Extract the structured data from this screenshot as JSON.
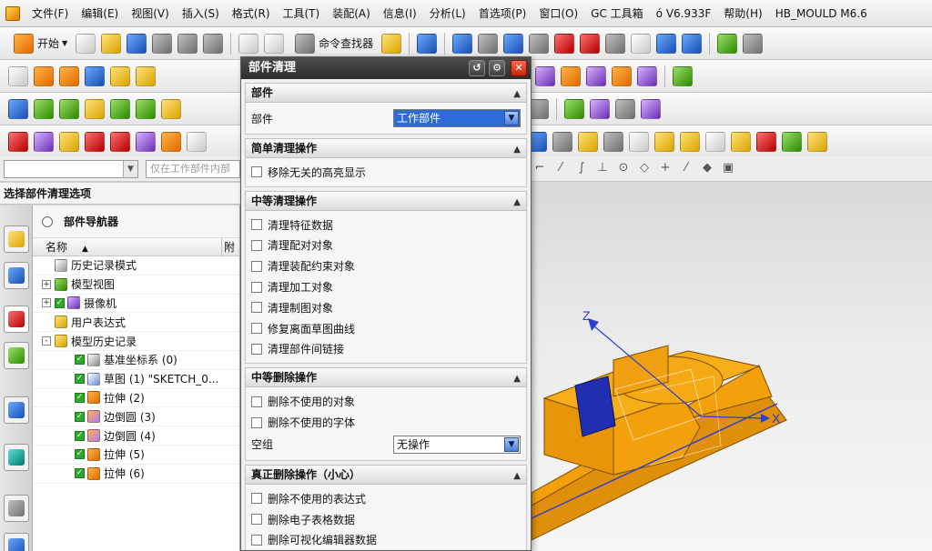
{
  "menubar": {
    "items": [
      "文件(F)",
      "编辑(E)",
      "视图(V)",
      "插入(S)",
      "格式(R)",
      "工具(T)",
      "装配(A)",
      "信息(I)",
      "分析(L)",
      "首选项(P)",
      "窗口(O)",
      "GC 工具箱",
      "ó V6.933F",
      "帮助(H)",
      "HB_MOULD M6.6"
    ]
  },
  "toolbar1": {
    "start_label": "开始",
    "command_finder_label": "命令查找器"
  },
  "selection_bar": {
    "hint_text": "仅在工作部件内部"
  },
  "prompt": {
    "text": "选择部件清理选项"
  },
  "navigator": {
    "title": "部件导航器",
    "column_name": "名称",
    "column_extra": "附",
    "items": [
      {
        "label": "历史记录模式",
        "level": 0,
        "expander": "",
        "checked": false,
        "icon": "clock-icon"
      },
      {
        "label": "模型视图",
        "level": 0,
        "expander": "+",
        "checked": false,
        "icon": "model-views-icon"
      },
      {
        "label": "摄像机",
        "level": 0,
        "expander": "+",
        "checked": true,
        "icon": "camera-icon"
      },
      {
        "label": "用户表达式",
        "level": 0,
        "expander": "",
        "checked": false,
        "icon": "folder-icon"
      },
      {
        "label": "模型历史记录",
        "level": 0,
        "expander": "-",
        "checked": false,
        "icon": "folder-icon"
      },
      {
        "label": "基准坐标系 (0)",
        "level": 1,
        "expander": "",
        "checked": true,
        "icon": "datum-csys-icon"
      },
      {
        "label": "草图 (1) \"SKETCH_0...",
        "level": 1,
        "expander": "",
        "checked": true,
        "icon": "sketch-icon"
      },
      {
        "label": "拉伸 (2)",
        "level": 1,
        "expander": "",
        "checked": true,
        "icon": "extrude-icon"
      },
      {
        "label": "边倒圆 (3)",
        "level": 1,
        "expander": "",
        "checked": true,
        "icon": "edge-blend-icon"
      },
      {
        "label": "边倒圆 (4)",
        "level": 1,
        "expander": "",
        "checked": true,
        "icon": "edge-blend-icon"
      },
      {
        "label": "拉伸 (5)",
        "level": 1,
        "expander": "",
        "checked": true,
        "icon": "extrude-icon"
      },
      {
        "label": "拉伸 (6)",
        "level": 1,
        "expander": "",
        "checked": true,
        "icon": "extrude-icon"
      }
    ]
  },
  "dialog": {
    "title": "部件清理",
    "sections": {
      "part": {
        "header": "部件",
        "field_label": "部件",
        "field_value": "工作部件"
      },
      "simple": {
        "header": "简单清理操作",
        "options": [
          "移除无关的高亮显示"
        ]
      },
      "medium_cleanup": {
        "header": "中等清理操作",
        "options": [
          "清理特征数据",
          "清理配对对象",
          "清理装配约束对象",
          "清理加工对象",
          "清理制图对象",
          "修复离面草图曲线",
          "清理部件间链接"
        ]
      },
      "medium_delete": {
        "header": "中等删除操作",
        "options": [
          "删除不使用的对象",
          "删除不使用的字体"
        ],
        "group_label": "空组",
        "group_value": "无操作"
      },
      "real_delete": {
        "header": "真正删除操作（小心）",
        "options": [
          "删除不使用的表达式",
          "删除电子表格数据",
          "删除可视化编辑器数据"
        ]
      }
    }
  },
  "viewport": {
    "axis_labels": {
      "z": "Z",
      "x": "X"
    },
    "model_color": "#f2a10c",
    "pocket_color": "#1f2fb0"
  }
}
